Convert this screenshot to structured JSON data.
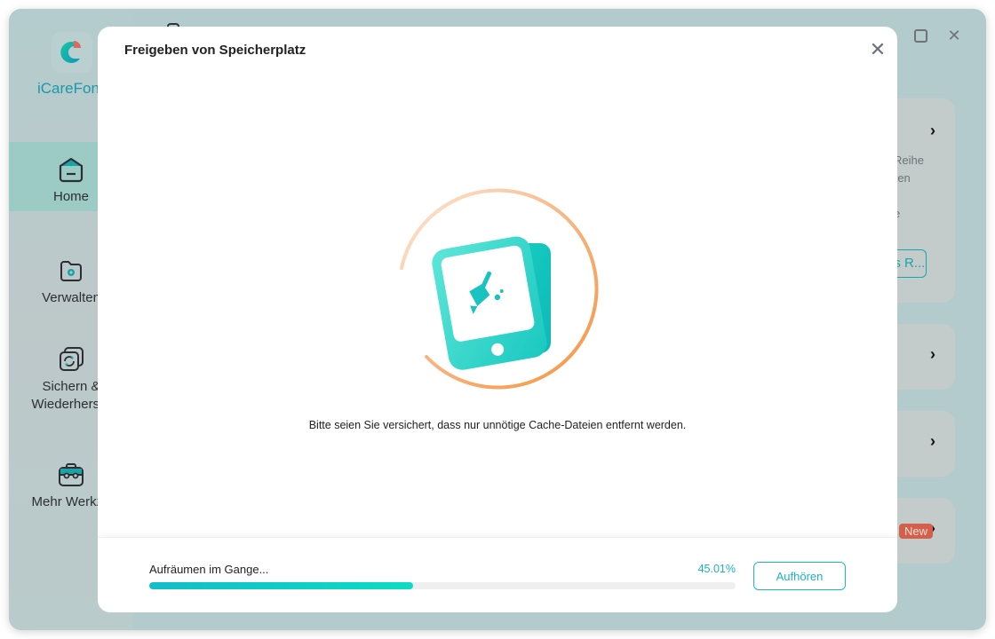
{
  "app": {
    "brand_name": "iCareFone",
    "brand_name_visible": "iCareFon",
    "window_controls": {
      "minimize": "minimize",
      "maximize": "maximize",
      "close": "close"
    }
  },
  "sidebar": {
    "items": [
      {
        "label": "Home",
        "icon": "home-icon",
        "active": true
      },
      {
        "label": "Verwalten",
        "icon": "folder-gear-icon",
        "active": false
      },
      {
        "label_line1": "Sichern &",
        "label_line2": "Wiederherste",
        "icon": "backup-restore-icon",
        "active": false
      },
      {
        "label": "Mehr Werkze",
        "icon": "toolbox-icon",
        "active": false
      }
    ]
  },
  "background_cards": {
    "card1": {
      "text_fragments": [
        "Reihe",
        "ren",
        "e"
      ],
      "button_fragment": "os R..."
    },
    "badge_new": "New"
  },
  "modal": {
    "title": "Freigeben von Speicherplatz",
    "close_icon": "close-icon",
    "illustration": "phone-cleaning-broom-icon",
    "message": "Bitte seien Sie versichert, dass nur unnötige Cache-Dateien entfernt werden.",
    "status_label": "Aufräumen im Gange...",
    "progress_percent": 45.01,
    "progress_text": "45.01%",
    "stop_button": "Aufhören"
  },
  "colors": {
    "accent": "#1bb3c0",
    "progress_start": "#12bdc8",
    "progress_end": "#0bdcc3",
    "ring_orange": "#f6a15a",
    "badge_new": "#d4604b",
    "sidebar_active": "#9ccbc6"
  }
}
